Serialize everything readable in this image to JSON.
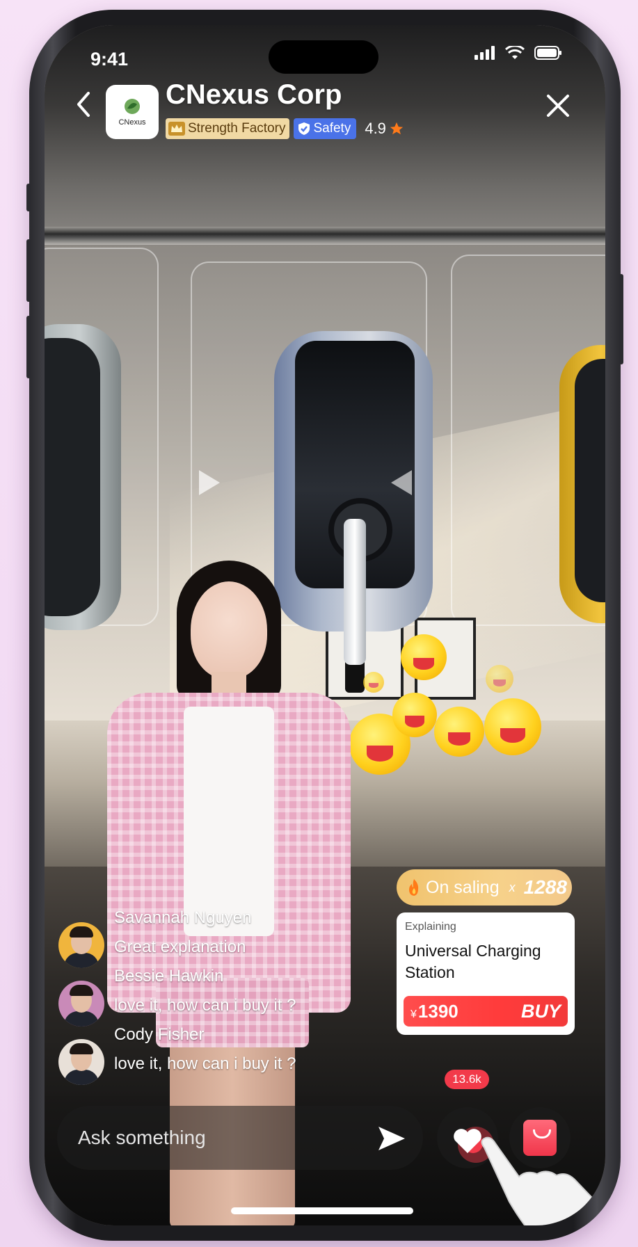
{
  "status_bar": {
    "time": "9:41"
  },
  "header": {
    "logo_text": "CNexus",
    "brand_name": "CNexus Corp",
    "badge_strength": "Strength Factory",
    "badge_safety": "Safety",
    "rating": "4.9"
  },
  "chat": [
    {
      "name": "Savannah Nguyen",
      "message": "Great explanation"
    },
    {
      "name": "Bessie Hawkin",
      "message": "love it, how can i buy it ?"
    },
    {
      "name": "Cody Fisher",
      "message": "love it, how can i buy it ?"
    }
  ],
  "on_sale": {
    "label": "On saling",
    "times": "x",
    "count": "1288"
  },
  "product_card": {
    "tag": "Explaining",
    "title": "Universal Charging Station",
    "currency": "¥",
    "price": "1390",
    "buy_label": "BUY"
  },
  "bottom_bar": {
    "ask_placeholder": "Ask something",
    "like_count": "13.6k"
  },
  "colors": {
    "buy_red": "#ff3b3b",
    "safety_blue": "#4a72e8",
    "strength_gold": "#f1d9a4",
    "like_badge": "#f23a4a",
    "background_pink": "#f3dcf4"
  }
}
